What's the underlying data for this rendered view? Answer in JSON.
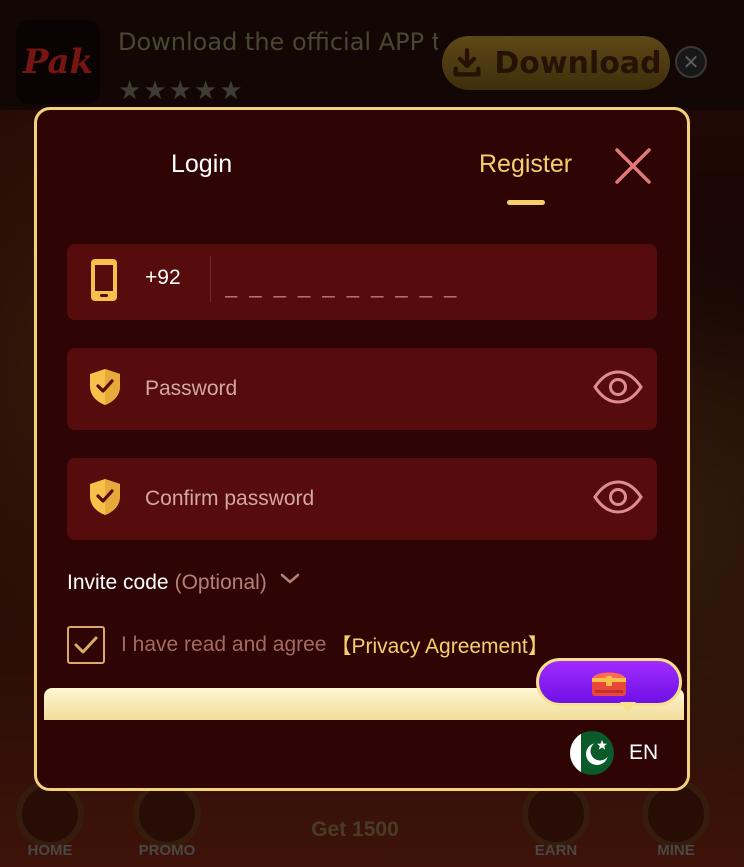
{
  "app_bar": {
    "logo_text": "Pak",
    "download_text": "Download the official APP t...",
    "stars": [
      "★",
      "★",
      "★",
      "★",
      "★"
    ],
    "download_label": "Download",
    "close_symbol": "✕"
  },
  "modal": {
    "tabs": [
      {
        "label": "Login",
        "active": false
      },
      {
        "label": "Register",
        "active": true
      }
    ],
    "phone": {
      "country_code": "+92",
      "placeholder": "_ _ _ _ _ _ _ _ _ _"
    },
    "password": {
      "placeholder": "Password"
    },
    "confirm_password": {
      "placeholder": "Confirm password"
    },
    "invite": {
      "label": "Invite code",
      "optional": "(Optional)"
    },
    "agreement": {
      "text": "I have read and agree",
      "link": "【Privacy Agreement】",
      "checked": true
    },
    "language": {
      "code": "EN"
    }
  },
  "bottom_nav": {
    "items": [
      "HOME",
      "PROMO",
      "EARN",
      "MINE"
    ],
    "center_label": "Get 1500"
  },
  "colors": {
    "accent_gold": "#f5cf6b",
    "modal_bg": "#2e0504",
    "field_bg": "#560c0c",
    "gift_purple": "#8a1ff5"
  }
}
